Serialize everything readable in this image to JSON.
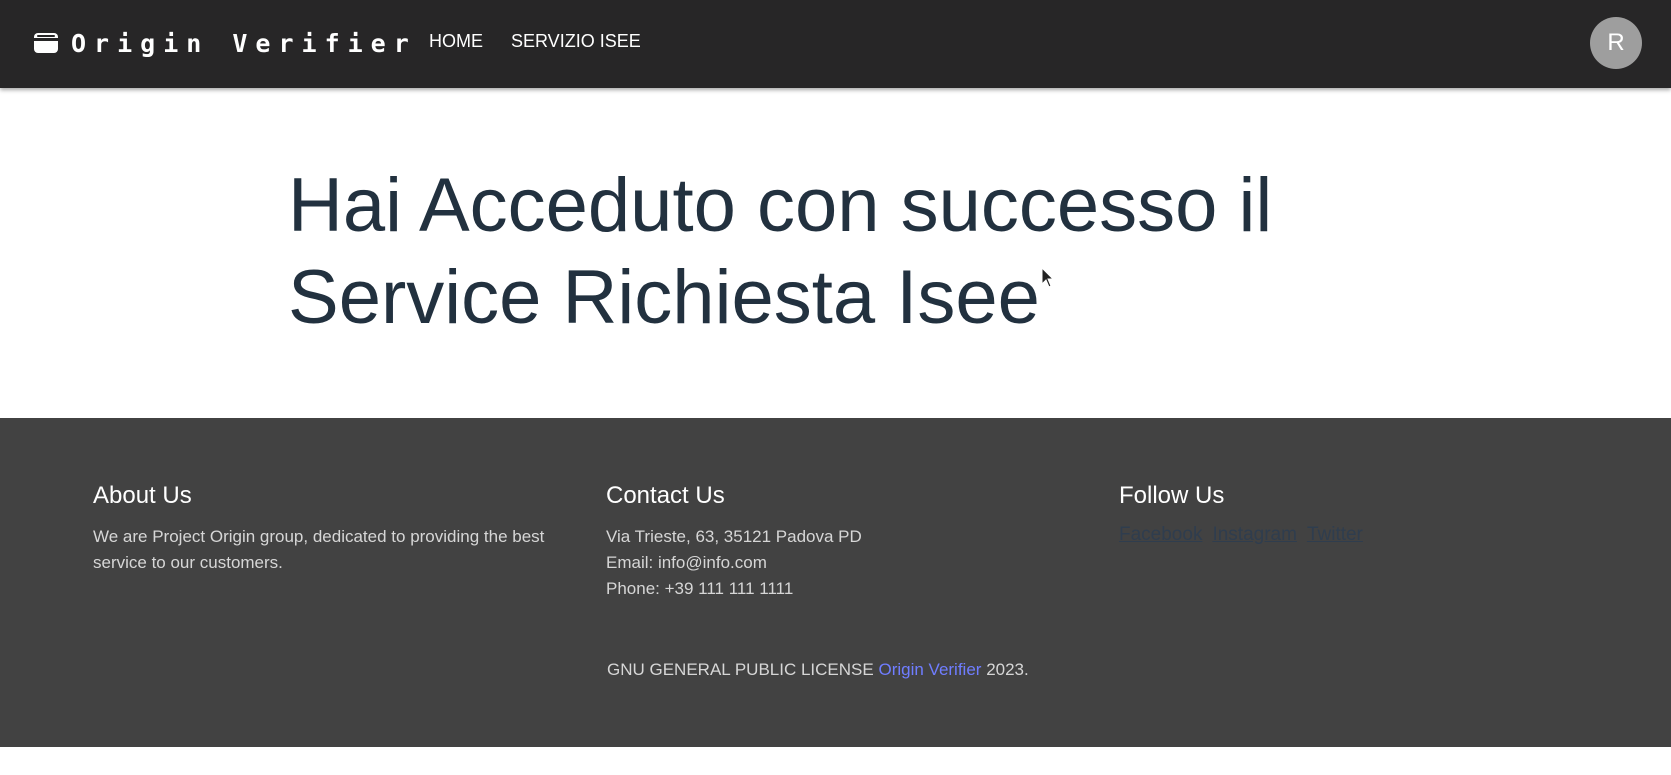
{
  "header": {
    "brand_name": "Origin Verifier",
    "brand_icon": "wallet-icon",
    "nav": [
      {
        "label": "HOME"
      },
      {
        "label": "SERVIZIO ISEE"
      }
    ],
    "avatar_initial": "R"
  },
  "main": {
    "heading": "Hai Acceduto con successo il Service Richiesta Isee"
  },
  "footer": {
    "about": {
      "title": "About Us",
      "text": "We are Project Origin group, dedicated to providing the best service to our customers."
    },
    "contact": {
      "title": "Contact Us",
      "address": "Via Trieste, 63, 35121 Padova PD",
      "email": "Email: info@info.com",
      "phone": "Phone: +39 111 111 1111"
    },
    "follow": {
      "title": "Follow Us",
      "links": [
        "Facebook",
        "Instagram",
        "Twitter"
      ]
    },
    "license": {
      "prefix": "GNU GENERAL PUBLIC LICENSE",
      "link": "Origin Verifier",
      "suffix": "2023."
    }
  },
  "colors": {
    "topbar_bg": "#272627",
    "footer_bg": "#424242",
    "heading_text": "#22313f",
    "license_link": "#6f7dff",
    "avatar_bg": "#9e9e9e"
  }
}
